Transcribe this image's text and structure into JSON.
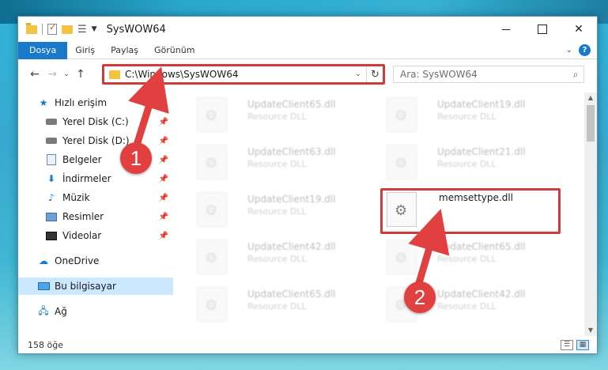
{
  "window": {
    "title": "SysWOW64"
  },
  "ribbon": {
    "tabs": [
      "Dosya",
      "Giriş",
      "Paylaş",
      "Görünüm"
    ],
    "help": "?"
  },
  "nav": {
    "back": "←",
    "forward": "→",
    "recent": "⌄",
    "up": "↑",
    "address": "C:\\Windows\\SysWOW64",
    "search_placeholder": "Ara: SysWOW64"
  },
  "sidebar": {
    "items": [
      {
        "label": "Hızlı erişim",
        "icon": "star-icon"
      },
      {
        "label": "Yerel Disk (C:)",
        "icon": "disk-icon",
        "pinned": true
      },
      {
        "label": "Yerel Disk (D:)",
        "icon": "disk-icon",
        "pinned": true
      },
      {
        "label": "Belgeler",
        "icon": "documents-icon",
        "pinned": true
      },
      {
        "label": "İndirmeler",
        "icon": "download-icon",
        "pinned": true
      },
      {
        "label": "Müzik",
        "icon": "music-icon",
        "pinned": true
      },
      {
        "label": "Resimler",
        "icon": "pictures-icon",
        "pinned": true
      },
      {
        "label": "Videolar",
        "icon": "videos-icon",
        "pinned": true
      },
      {
        "label": "OneDrive",
        "icon": "cloud-icon"
      },
      {
        "label": "Bu bilgisayar",
        "icon": "computer-icon",
        "selected": true
      },
      {
        "label": "Ağ",
        "icon": "network-icon"
      }
    ]
  },
  "files": [
    {
      "name": "UpdateClient65.dll",
      "desc": "Resource DLL"
    },
    {
      "name": "UpdateClient19.dll",
      "desc": "Resource DLL"
    },
    {
      "name": "UpdateClient63.dll",
      "desc": "Resource DLL"
    },
    {
      "name": "UpdateClient21.dll",
      "desc": "Resource DLL"
    },
    {
      "name": "UpdateClient19.dll",
      "desc": "Resource DLL"
    },
    {
      "name": "memsettype.dll",
      "desc": ""
    },
    {
      "name": "UpdateClient42.dll",
      "desc": "Resource DLL"
    },
    {
      "name": "UpdateClient65.dll",
      "desc": "Resource DLL"
    },
    {
      "name": "UpdateClient65.dll",
      "desc": "Resource DLL"
    },
    {
      "name": "UpdateClient42.dll",
      "desc": "Resource DLL"
    }
  ],
  "status": {
    "count": "158 öğe"
  },
  "callouts": [
    "1",
    "2"
  ],
  "colors": {
    "accent": "#1979ca",
    "highlight": "#d23b3b",
    "selection": "#cce8ff"
  }
}
